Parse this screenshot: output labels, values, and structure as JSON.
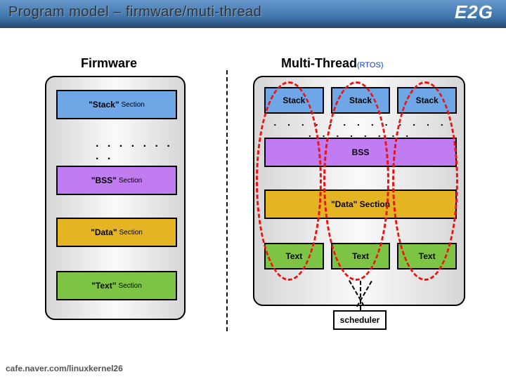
{
  "header": {
    "title": "Program model – firmware/muti-thread",
    "logo": "E2G"
  },
  "firmware": {
    "title": "Firmware",
    "stack": "\"Stack\"",
    "stack_sub": "Section",
    "bss": "\"BSS\"",
    "bss_sub": "Section",
    "data": "\"Data\"",
    "data_sub": "Section",
    "text": "\"Text\"",
    "text_sub": "Section",
    "ellipsis": ". . . . . . . . ."
  },
  "mt": {
    "title": "Multi-Thread",
    "subtitle": "(RTOS)",
    "stack": [
      "Stack",
      "Stack",
      "Stack"
    ],
    "ellipsis": ". . . . . . . . . . . . . . . . . . . . .",
    "bss": "BSS",
    "data": "\"Data\" Section",
    "text": [
      "Text",
      "Text",
      "Text"
    ],
    "scheduler": "scheduler"
  },
  "footer": "cafe.naver.com/linuxkernel26"
}
